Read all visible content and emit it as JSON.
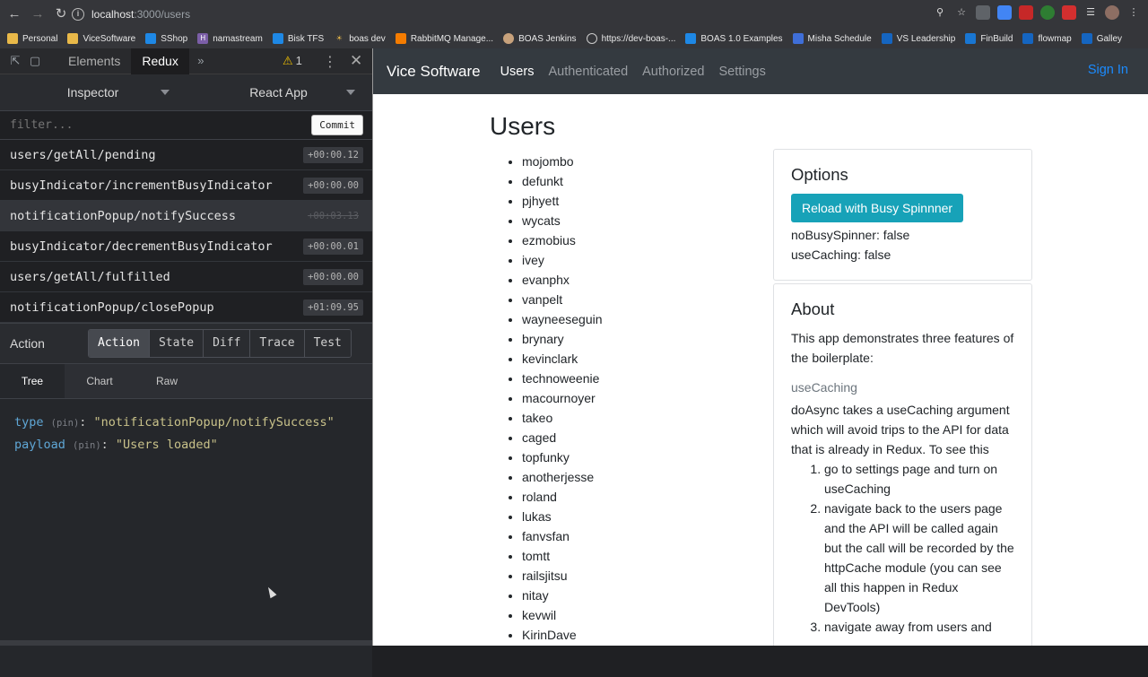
{
  "browser": {
    "host": "localhost",
    "path": ":3000/users",
    "bookmarks": [
      "Personal",
      "ViceSoftware",
      "SShop",
      "namastream",
      "Bisk TFS",
      "boas dev",
      "RabbitMQ Manage...",
      "BOAS Jenkins",
      "https://dev-boas-...",
      "BOAS 1.0 Examples",
      "Misha Schedule",
      "VS Leadership",
      "FinBuild",
      "flowmap",
      "Galley"
    ]
  },
  "devtools": {
    "tabs": [
      "Elements",
      "Redux"
    ],
    "warning_count": "1",
    "inspector_label": "Inspector",
    "app_label": "React App",
    "filter_placeholder": "filter...",
    "commit_label": "Commit",
    "actions": [
      {
        "name": "users/getAll/pending",
        "time": "+00:00.12"
      },
      {
        "name": "busyIndicator/incrementBusyIndicator",
        "time": "+00:00.00"
      },
      {
        "name": "notificationPopup/notifySuccess",
        "time": "+00:03.13"
      },
      {
        "name": "busyIndicator/decrementBusyIndicator",
        "time": "+00:00.01"
      },
      {
        "name": "users/getAll/fulfilled",
        "time": "+00:00.00"
      },
      {
        "name": "notificationPopup/closePopup",
        "time": "+01:09.95"
      }
    ],
    "monitor_title": "Action",
    "monitor_tabs": [
      "Action",
      "State",
      "Diff",
      "Trace",
      "Test"
    ],
    "sub_tabs": [
      "Tree",
      "Chart",
      "Raw"
    ],
    "tree": {
      "type_key": "type",
      "type_value": "\"notificationPopup/notifySuccess\"",
      "payload_key": "payload",
      "payload_value": "\"Users loaded\"",
      "pin": "(pin)"
    }
  },
  "app": {
    "brand": "Vice Software",
    "nav": [
      "Users",
      "Authenticated",
      "Authorized",
      "Settings"
    ],
    "signin": "Sign In",
    "page_title": "Users",
    "users": [
      "mojombo",
      "defunkt",
      "pjhyett",
      "wycats",
      "ezmobius",
      "ivey",
      "evanphx",
      "vanpelt",
      "wayneeseguin",
      "brynary",
      "kevinclark",
      "technoweenie",
      "macournoyer",
      "takeo",
      "caged",
      "topfunky",
      "anotherjesse",
      "roland",
      "lukas",
      "fanvsfan",
      "tomtt",
      "railsjitsu",
      "nitay",
      "kevwil",
      "KirinDave"
    ],
    "options": {
      "title": "Options",
      "button": "Reload with Busy Spinnner",
      "line1": "noBusySpinner: false",
      "line2": "useCaching: false"
    },
    "about": {
      "title": "About",
      "intro": "This app demonstrates three features of the boilerplate:",
      "subtitle": "useCaching",
      "desc": "doAsync takes a useCaching argument which will avoid trips to the API for data that is already in Redux. To see this",
      "steps": [
        "go to settings page and turn on useCaching",
        "navigate back to the users page and the API will be called again but the call will be recorded by the httpCache module (you can see all this happen in Redux DevTools)",
        "navigate away from users and"
      ]
    }
  }
}
